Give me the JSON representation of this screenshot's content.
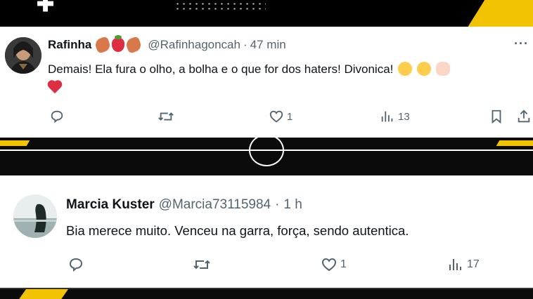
{
  "tweets": [
    {
      "name": "Rafinha",
      "handle": "@Rafinhagoncah",
      "separator": "·",
      "time": "47 min",
      "more": "···",
      "text": "Demais! Ela fura o olho, a bolha e o que for dos haters! Divonica!",
      "emojis": [
        "leaf-icon",
        "strawberry-icon",
        "leaf-icon"
      ],
      "text_emojis": [
        "pleading-face-icon",
        "grinning-squinting-face-icon",
        "clapping-hands-icon",
        "red-heart-icon"
      ],
      "actions": {
        "reply_count": "",
        "retweet_count": "",
        "like_count": "1",
        "views_count": "13"
      }
    },
    {
      "name": "Marcia Kuster",
      "handle": "@Marcia73115984",
      "separator": "·",
      "time": "1 h",
      "text": "Bia merece muito. Venceu na garra, força, sendo autentica.",
      "actions": {
        "reply_count": "",
        "retweet_count": "",
        "like_count": "1",
        "views_count": "17"
      }
    }
  ],
  "colors": {
    "accent_yellow": "#f2c300",
    "text_primary": "#0f1419",
    "text_secondary": "#536471",
    "heart_red": "#dd2e44"
  }
}
